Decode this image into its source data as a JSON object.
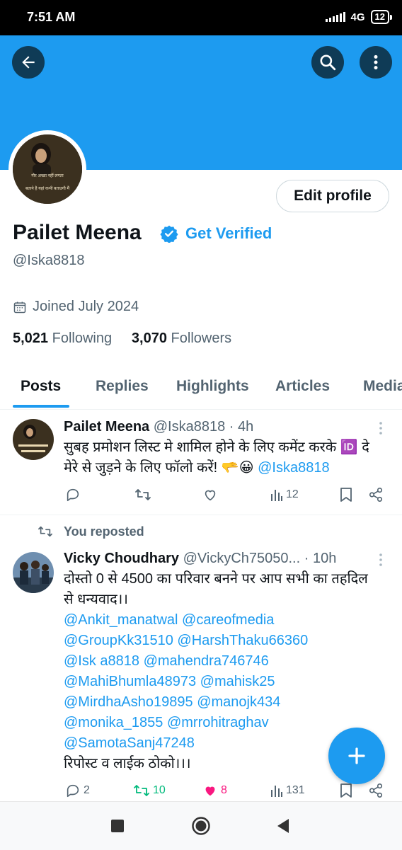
{
  "status": {
    "time": "7:51 AM",
    "network": "4G",
    "battery": "12"
  },
  "colors": {
    "banner": "#1d9bf0",
    "accent": "#1d9bf0",
    "like": "#f91880",
    "repost": "#00ba7c"
  },
  "header": {
    "back_icon": "back-arrow-icon",
    "search_icon": "search-icon",
    "more_icon": "more-vertical-icon"
  },
  "profile": {
    "avatar_lines": [
      "गौर अच्छा नहीं लगता",
      "बताने है यहां कभी बताउगी मैं"
    ],
    "edit_label": "Edit profile",
    "display_name": "Pailet Meena",
    "get_verified": "Get Verified",
    "handle": "@Iska8818",
    "joined": "Joined July 2024",
    "following_count": "5,021",
    "following_label": "Following",
    "followers_count": "3,070",
    "followers_label": "Followers"
  },
  "tabs": [
    "Posts",
    "Replies",
    "Highlights",
    "Articles",
    "Media"
  ],
  "posts": [
    {
      "name": "Pailet Meena",
      "meta": "@Iska8818 · 4h",
      "line1": "सुबह प्रमोशन लिस्ट मे शामिल होने के लिए कमेंट करके 🆔 दे",
      "line2": "मेरे से जुड़ने के लिए फॉलो करें! 🫳😀",
      "line2_mention": "@Iska8818",
      "views": "12"
    },
    {
      "repost_label": "You reposted",
      "name": "Vicky Choudhary",
      "meta": "@VickyCh75050... · 10h",
      "text1": "दोस्तो 0 से 4500 का परिवार बनने पर आप सभी का तहदिल",
      "text2": "से धन्यवाद।।",
      "mention_lines": [
        "@Ankit_manatwal @careofmedia",
        "@GroupKk31510 @HarshThaku66360",
        "@Isk a8818 @mahendra746746",
        "@MahiBhumla48973 @mahisk25",
        "@MirdhaAsho19895 @manojk434",
        "@monika_1855 @mrrohitraghav",
        "@SamotaSanj47248"
      ],
      "text3": "रिपोस्ट व लाईक ठोको।।।",
      "replies": "2",
      "reposts": "10",
      "likes": "8",
      "views": "131"
    }
  ]
}
